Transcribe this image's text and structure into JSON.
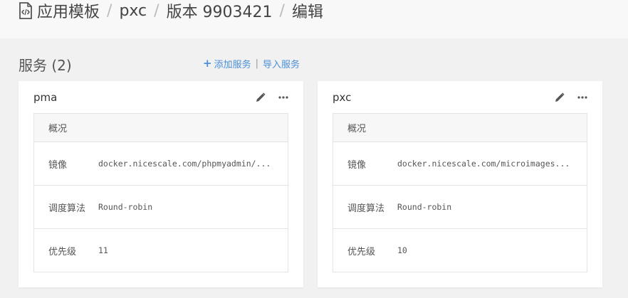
{
  "breadcrumb": {
    "items": [
      "应用模板",
      "pxc",
      "版本 9903421",
      "编辑"
    ],
    "separator": "/"
  },
  "section": {
    "title": "服务 (2)",
    "add_label": "添加服务",
    "import_label": "导入服务",
    "separator": "|"
  },
  "services": [
    {
      "name": "pma",
      "overview_label": "概况",
      "rows": [
        {
          "label": "镜像",
          "value": "docker.nicescale.com/phpmyadmin/..."
        },
        {
          "label": "调度算法",
          "value": "Round-robin"
        },
        {
          "label": "优先级",
          "value": "11"
        }
      ]
    },
    {
      "name": "pxc",
      "overview_label": "概况",
      "rows": [
        {
          "label": "镜像",
          "value": "docker.nicescale.com/microimages..."
        },
        {
          "label": "调度算法",
          "value": "Round-robin"
        },
        {
          "label": "优先级",
          "value": "10"
        }
      ]
    }
  ],
  "colors": {
    "link": "#4a90d9",
    "background": "#f1f1f1",
    "card": "#ffffff"
  },
  "icons": [
    "code-file-icon",
    "plus-icon",
    "pencil-icon",
    "more-icon"
  ]
}
